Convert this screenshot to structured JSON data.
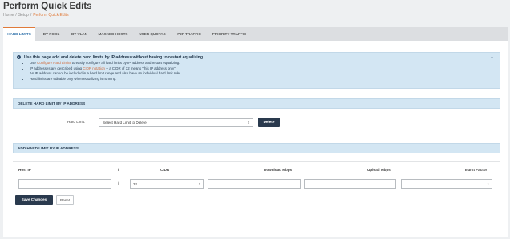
{
  "header": {
    "title": "Perform Quick Edits",
    "breadcrumb": [
      "Home",
      "Setup",
      "Perform Quick Edits"
    ]
  },
  "tabs": [
    {
      "label": "HARD LIMITS",
      "active": true
    },
    {
      "label": "BY POOL",
      "active": false
    },
    {
      "label": "BY VLAN",
      "active": false
    },
    {
      "label": "MASKED HOSTS",
      "active": false
    },
    {
      "label": "USER QUOTAS",
      "active": false
    },
    {
      "label": "P2P TRAFFIC",
      "active": false
    },
    {
      "label": "PRIORITY TRAFFIC",
      "active": false
    }
  ],
  "info": {
    "title": "Use this page add and delete hard limits by IP address without having to restart equalizing.",
    "bullets": [
      {
        "pre": "Use ",
        "link": "Configure Hard Limits",
        "post": " to easily configure all hard limits by IP address and restart equalizing."
      },
      {
        "pre": "IP addresses are described using ",
        "link": "CIDR notation",
        "post": " -- a CIDR of 32 means \"this IP address only\"."
      },
      {
        "pre": "An IP address cannot be included in a hard limit range and also have an individual hard limit rule.",
        "link": "",
        "post": ""
      },
      {
        "pre": "Hard limits are editable only when equalizing is running.",
        "link": "",
        "post": ""
      }
    ]
  },
  "delete_section": {
    "heading": "DELETE HARD LIMIT BY IP ADDRESS",
    "field_label": "Hard Limit:",
    "select_value": "Select Hard Limit to Delete",
    "delete_button": "Delete"
  },
  "add_section": {
    "heading": "ADD HARD LIMIT BY IP ADDRESS",
    "columns": {
      "host_ip": "Host IP",
      "slash": "/",
      "cidr": "CIDR",
      "download": "Download Mbps",
      "upload": "Upload Mbps",
      "burst": "Burst Factor"
    },
    "values": {
      "host_ip": "",
      "cidr": "32",
      "download": "",
      "upload": "",
      "burst": "1"
    },
    "save_button": "Save Changes",
    "reset_button": "Reset"
  },
  "colors": {
    "accent_orange": "#e07a3a",
    "info_blue": "#d3e6f3",
    "dark_button": "#2a3a4e"
  }
}
